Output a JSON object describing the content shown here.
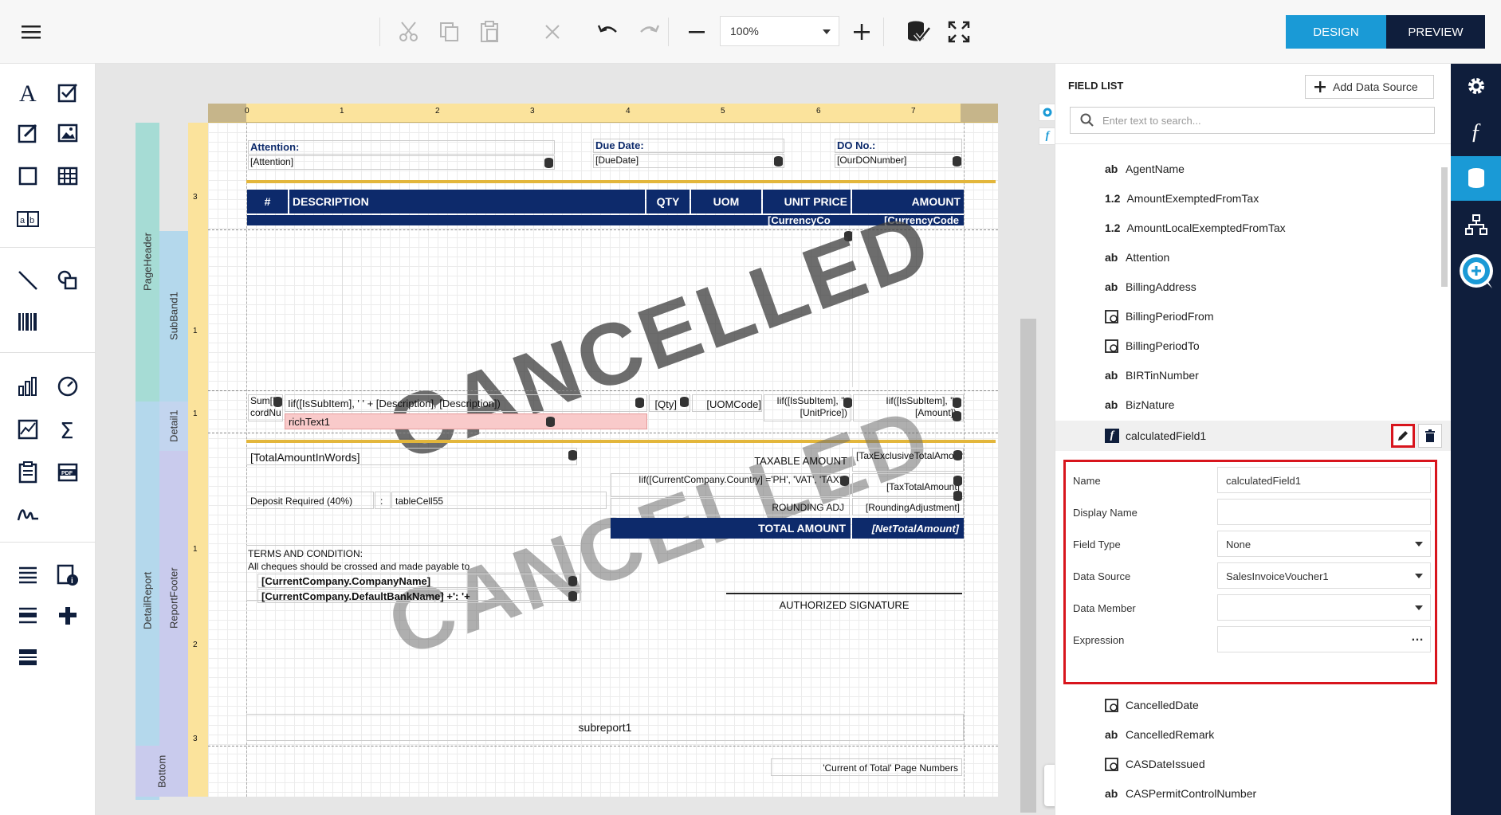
{
  "toolbar": {
    "zoom_value": "100%",
    "design_label": "DESIGN",
    "preview_label": "PREVIEW"
  },
  "bands": {
    "page_header": "PageHeader",
    "sub_band": "SubBand1",
    "detail": "Detail1",
    "detail_report": "DetailReport",
    "report_footer": "ReportFooter",
    "bottom": "Bottom"
  },
  "ruler": {
    "top_ticks": [
      "0",
      "1",
      "2",
      "3",
      "4",
      "5",
      "6",
      "7"
    ],
    "left_ticks": [
      "3",
      "1",
      "1",
      "1",
      "2",
      "3"
    ]
  },
  "report": {
    "attention_label": "Attention:",
    "attention_value": "[Attention]",
    "due_date_label": "Due Date:",
    "due_date_value": "[DueDate]",
    "do_no_label": "DO No.:",
    "do_no_value": "[OurDONumber]",
    "col_hash": "#",
    "col_description": "DESCRIPTION",
    "col_qty": "QTY",
    "col_uom": "UOM",
    "col_unit_price": "UNIT PRICE",
    "col_amount": "AMOUNT",
    "currency_1": "[CurrencyCo",
    "currency_2": "[CurrencyCode",
    "watermark": "CANCELLED",
    "d_sum": "Sum[Re cordNu",
    "d_desc": "Iif([IsSubItem], '    ' + [Description], [Description])",
    "d_qty": "[Qty]",
    "d_uom": "[UOMCode]",
    "d_unit_price": "Iif([IsSubItem], '', [UnitPrice])",
    "d_amount": "Iif([IsSubItem], '', [Amount])",
    "rich_text": "richText1",
    "total_words": "[TotalAmountInWords]",
    "taxable_amount": "TAXABLE AMOUNT",
    "tax_exclusive": "[TaxExclusiveTotalAmount]",
    "vat_expr": "Iif([CurrentCompany.Country] ='PH', 'VAT', 'TAX')",
    "tax_total": "[TaxTotalAmount]",
    "deposit": "Deposit Required (40%)",
    "colon": ":",
    "table_cell": "tableCell55",
    "rounding_adj": "ROUNDING ADJ",
    "rounding_value": "[RoundingAdjustment]",
    "total_amount": "TOTAL AMOUNT",
    "net_total": "[NetTotalAmount]",
    "terms_title": "TERMS AND CONDITION:",
    "terms_text": "All cheques should be crossed and made payable to",
    "company_name": "[CurrentCompany.CompanyName]",
    "bank_name": "[CurrentCompany.DefaultBankName] +': '+",
    "authorized_signature": "AUTHORIZED SIGNATURE",
    "subreport": "subreport1",
    "page_numbers": "'Current of Total' Page Numbers"
  },
  "field_list": {
    "title": "FIELD LIST",
    "add_data_source": "Add Data Source",
    "search_placeholder": "Enter text to search...",
    "items_top": [
      {
        "type": "ab",
        "name": "AgentName"
      },
      {
        "type": "1.2",
        "name": "AmountExemptedFromTax"
      },
      {
        "type": "1.2",
        "name": "AmountLocalExemptedFromTax"
      },
      {
        "type": "ab",
        "name": "Attention"
      },
      {
        "type": "ab",
        "name": "BillingAddress"
      },
      {
        "type": "date",
        "name": "BillingPeriodFrom"
      },
      {
        "type": "date",
        "name": "BillingPeriodTo"
      },
      {
        "type": "ab",
        "name": "BIRTinNumber"
      },
      {
        "type": "ab",
        "name": "BizNature"
      }
    ],
    "selected_item": "calculatedField1",
    "items_bottom": [
      {
        "type": "date",
        "name": "CancelledDate"
      },
      {
        "type": "ab",
        "name": "CancelledRemark"
      },
      {
        "type": "date",
        "name": "CASDateIssued"
      },
      {
        "type": "ab",
        "name": "CASPermitControlNumber"
      }
    ]
  },
  "properties": {
    "name_label": "Name",
    "name_value": "calculatedField1",
    "display_name_label": "Display Name",
    "display_name_value": "",
    "field_type_label": "Field Type",
    "field_type_value": "None",
    "data_source_label": "Data Source",
    "data_source_value": "SalesInvoiceVoucher1",
    "data_member_label": "Data Member",
    "data_member_value": "",
    "expression_label": "Expression",
    "expression_value": "",
    "expression_ellipsis": "…"
  }
}
